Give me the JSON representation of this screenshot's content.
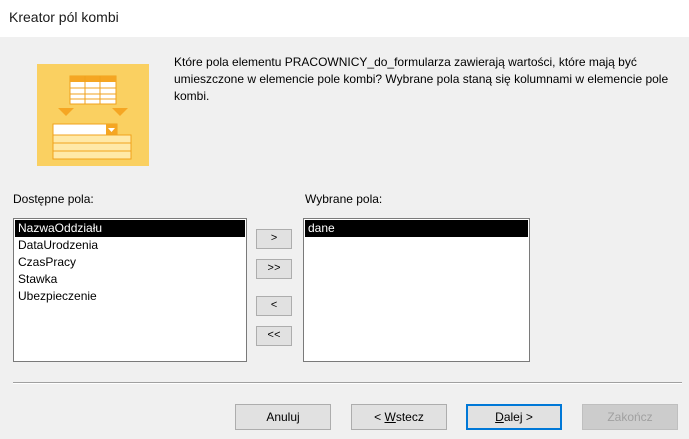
{
  "window": {
    "title": "Kreator pól kombi"
  },
  "intro_text": "Które pola elementu PRACOWNICY_do_formularza zawierają wartości, które mają być umieszczone w elemencie pole kombi? Wybrane pola staną się kolumnami w elemencie pole kombi.",
  "available": {
    "label": "Dostępne pola:",
    "items": [
      "NazwaOddziału",
      "DataUrodzenia",
      "CzasPracy",
      "Stawka",
      "Ubezpieczenie"
    ],
    "selected_index": 0
  },
  "selected": {
    "label": "Wybrane pola:",
    "items": [
      "dane"
    ],
    "selected_index": 0
  },
  "move_buttons": {
    "add_one": ">",
    "add_all": ">>",
    "remove_one": "<",
    "remove_all": "<<"
  },
  "footer": {
    "cancel": "Anuluj",
    "back_prefix": "< ",
    "back_key": "W",
    "back_rest": "stecz",
    "next_key": "D",
    "next_rest": "alej >",
    "finish": "Zakończ"
  },
  "colors": {
    "selection": "#000000",
    "default_button_border": "#0078d7",
    "art_orange": "#f5a623",
    "art_yellow": "#fbd66b"
  }
}
